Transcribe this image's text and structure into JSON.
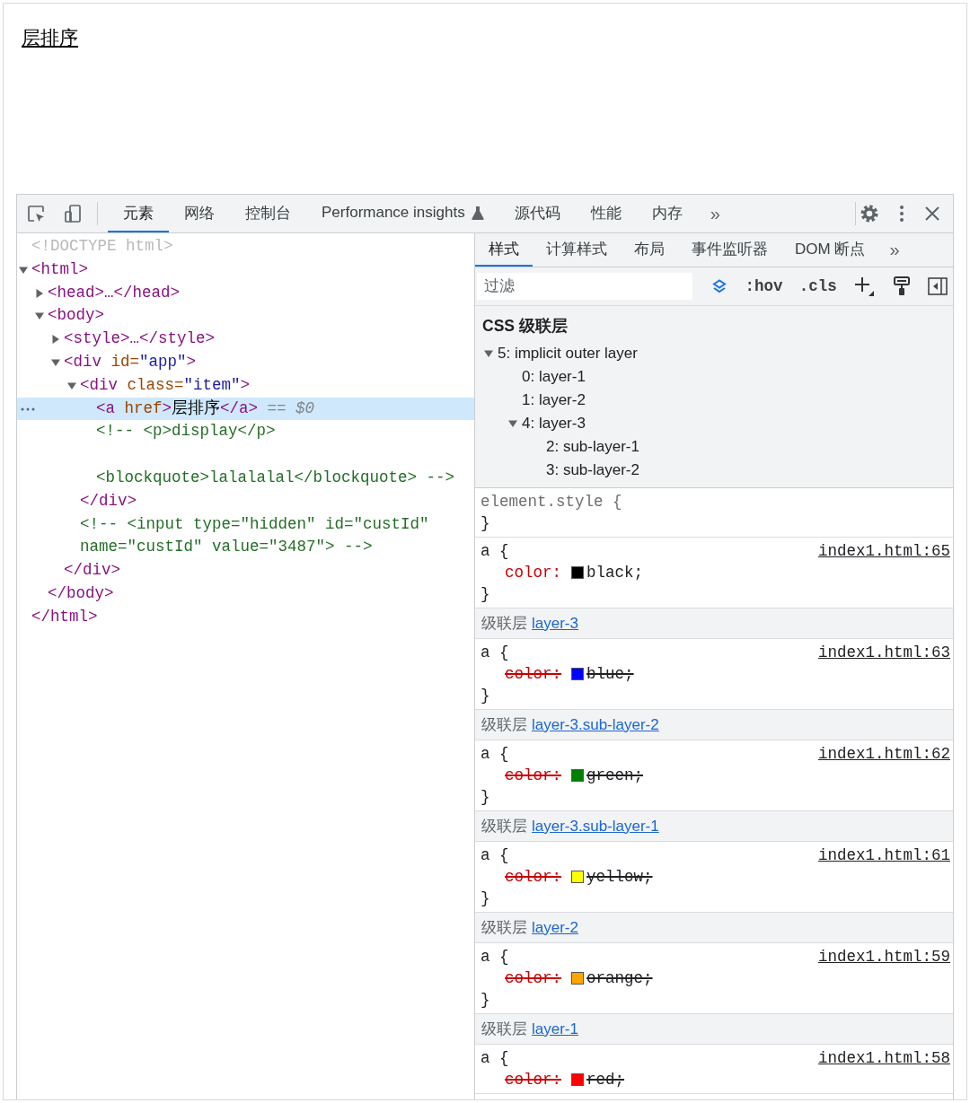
{
  "page": {
    "link": "层排序"
  },
  "devtools": {
    "tabs": [
      {
        "label": "元素",
        "selected": true,
        "kind": "plain"
      },
      {
        "label": "网络",
        "selected": false,
        "kind": "plain"
      },
      {
        "label": "控制台",
        "selected": false,
        "kind": "plain"
      },
      {
        "label": "Performance insights",
        "selected": false,
        "kind": "experimental"
      },
      {
        "label": "源代码",
        "selected": false,
        "kind": "plain"
      },
      {
        "label": "性能",
        "selected": false,
        "kind": "plain"
      },
      {
        "label": "内存",
        "selected": false,
        "kind": "plain"
      }
    ],
    "more_tabs": "»",
    "elements": {
      "nodes": [
        {
          "kind": "doctype",
          "text": "<!DOCTYPE html>",
          "selected": false
        },
        {
          "kind": "element",
          "parts": [
            {
              "kind": "tag",
              "text": "<html>"
            }
          ],
          "expanded": true,
          "selected": false,
          "closing": "</html>",
          "children": [
            {
              "kind": "element",
              "parts": [
                {
                  "kind": "tag",
                  "text": "<head>…</head>"
                }
              ],
              "expanded": false,
              "selected": false
            },
            {
              "kind": "element",
              "parts": [
                {
                  "kind": "tag",
                  "text": "<body>"
                }
              ],
              "expanded": true,
              "selected": false,
              "closing": "</body>",
              "children": [
                {
                  "kind": "element",
                  "parts": [
                    {
                      "kind": "tag",
                      "text": "<style>…</style>"
                    }
                  ],
                  "expanded": false,
                  "selected": false
                },
                {
                  "kind": "element",
                  "parts": [
                    {
                      "kind": "tag",
                      "text": "<div "
                    },
                    {
                      "kind": "attr",
                      "text": "id="
                    },
                    {
                      "kind": "value",
                      "text": "\"app\""
                    },
                    {
                      "kind": "tag",
                      "text": ">"
                    }
                  ],
                  "expanded": true,
                  "selected": false,
                  "closing": "</div>",
                  "children": [
                    {
                      "kind": "element",
                      "parts": [
                        {
                          "kind": "tag",
                          "text": "<div "
                        },
                        {
                          "kind": "attr",
                          "text": "class="
                        },
                        {
                          "kind": "value",
                          "text": "\"item\""
                        },
                        {
                          "kind": "tag",
                          "text": ">"
                        }
                      ],
                      "expanded": true,
                      "selected": false,
                      "closing": "</div>",
                      "children": [
                        {
                          "kind": "element",
                          "parts": [
                            {
                              "kind": "tag",
                              "text": "<a "
                            },
                            {
                              "kind": "attr",
                              "text": "href"
                            },
                            {
                              "kind": "tag",
                              "text": ">"
                            },
                            {
                              "kind": "text",
                              "text": "层排序"
                            },
                            {
                              "kind": "tag",
                              "text": "</a>"
                            }
                          ],
                          "suffix": "== *$0*",
                          "selected": true
                        },
                        {
                          "kind": "comment",
                          "text": "<!-- <p>display</p>\n\n<blockquote>lalalalal</blockquote> -->",
                          "selected": false
                        }
                      ]
                    },
                    {
                      "kind": "comment",
                      "text": "<!-- <input type=\"hidden\" id=\"custId\"\nname=\"custId\" value=\"3487\"> -->",
                      "selected": false
                    }
                  ]
                }
              ]
            }
          ]
        }
      ]
    },
    "styles": {
      "tabs": [
        {
          "label": "样式",
          "selected": true
        },
        {
          "label": "计算样式",
          "selected": false
        },
        {
          "label": "布局",
          "selected": false
        },
        {
          "label": "事件监听器",
          "selected": false
        },
        {
          "label": "DOM 断点",
          "selected": false
        }
      ],
      "more_tabs": "»",
      "filter": {
        "placeholder": "过滤"
      },
      "hov": ":hov",
      "cls": ".cls",
      "cascade_layers": {
        "title": "CSS 级联层",
        "layers": [
          {
            "label": "5: implicit outer layer",
            "expanded": true,
            "children": [
              {
                "label": "0: layer-1"
              },
              {
                "label": "1: layer-2"
              },
              {
                "label": "4: layer-3",
                "expanded": true,
                "children": [
                  {
                    "label": "2: sub-layer-1"
                  },
                  {
                    "label": "3: sub-layer-2"
                  }
                ]
              }
            ]
          }
        ]
      },
      "rules": [
        {
          "kind": "inline",
          "selector": "element.style {",
          "close": "}"
        },
        {
          "kind": "rule",
          "selector": "a {",
          "source": "index1.html:65",
          "declarations": [
            {
              "property": "color:",
              "color": "#000000",
              "value": "black;",
              "overridden": false
            }
          ],
          "close": "}"
        },
        {
          "kind": "layer-header",
          "label": "级联层",
          "layer": "layer-3"
        },
        {
          "kind": "rule",
          "selector": "a {",
          "source": "index1.html:63",
          "declarations": [
            {
              "property": "color:",
              "color": "#0000ff",
              "value": "blue;",
              "overridden": true
            }
          ],
          "close": "}"
        },
        {
          "kind": "layer-header",
          "label": "级联层",
          "layer": "layer-3.sub-layer-2"
        },
        {
          "kind": "rule",
          "selector": "a {",
          "source": "index1.html:62",
          "declarations": [
            {
              "property": "color:",
              "color": "#008000",
              "value": "green;",
              "overridden": true
            }
          ],
          "close": "}"
        },
        {
          "kind": "layer-header",
          "label": "级联层",
          "layer": "layer-3.sub-layer-1"
        },
        {
          "kind": "rule",
          "selector": "a {",
          "source": "index1.html:61",
          "declarations": [
            {
              "property": "color:",
              "color": "#ffff00",
              "value": "yellow;",
              "overridden": true
            }
          ],
          "close": "}"
        },
        {
          "kind": "layer-header",
          "label": "级联层",
          "layer": "layer-2"
        },
        {
          "kind": "rule",
          "selector": "a {",
          "source": "index1.html:59",
          "declarations": [
            {
              "property": "color:",
              "color": "#ffa500",
              "value": "orange;",
              "overridden": true
            }
          ],
          "close": "}"
        },
        {
          "kind": "layer-header",
          "label": "级联层",
          "layer": "layer-1"
        },
        {
          "kind": "rule",
          "selector": "a {",
          "source": "index1.html:58",
          "declarations": [
            {
              "property": "color:",
              "color": "#ff0000",
              "value": "red;",
              "overridden": true
            }
          ]
        }
      ]
    }
  }
}
